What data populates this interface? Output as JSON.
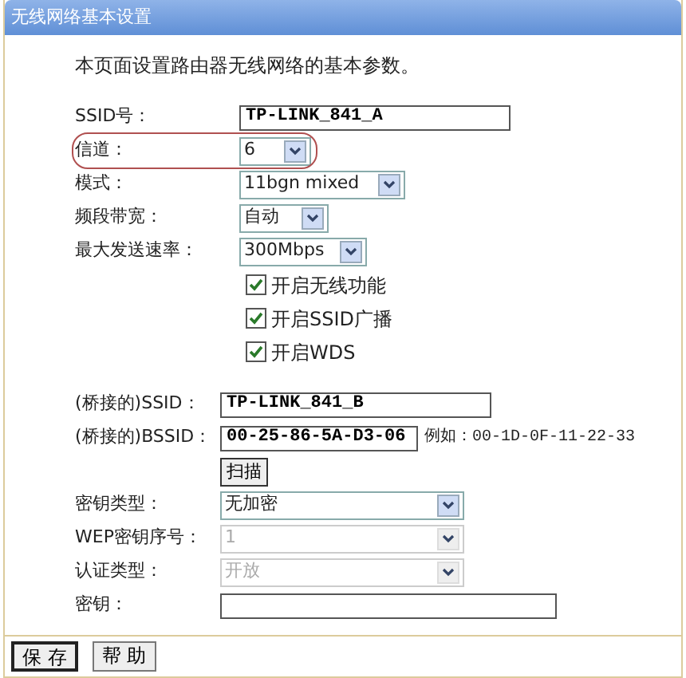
{
  "window": {
    "title": "无线网络基本设置"
  },
  "intro": "本页面设置路由器无线网络的基本参数。",
  "sections": [
    {
      "fields": [
        {
          "kind": "text",
          "label": "SSID号：",
          "value": "TP-LINK_841_A",
          "circled": false
        },
        {
          "kind": "select",
          "label": "信道：",
          "value": "6",
          "disabled": false,
          "circled": true
        },
        {
          "kind": "select",
          "label": "模式：",
          "value": "11bgn mixed",
          "disabled": false,
          "circled": false
        },
        {
          "kind": "select",
          "label": "频段带宽：",
          "value": "自动",
          "disabled": false,
          "circled": false
        },
        {
          "kind": "select",
          "label": "最大发送速率：",
          "value": "300Mbps",
          "disabled": false,
          "circled": false
        },
        {
          "kind": "checkbox",
          "text": "开启无线功能",
          "checked": true,
          "circled": false
        },
        {
          "kind": "checkbox",
          "text": "开启SSID广播",
          "checked": true,
          "circled": false
        },
        {
          "kind": "checkbox",
          "text": "开启WDS",
          "checked": true,
          "circled": false
        }
      ]
    },
    {
      "fields": [
        {
          "kind": "text",
          "label": "(桥接的)SSID：",
          "value": "TP-LINK_841_B",
          "circled": false
        },
        {
          "kind": "text",
          "label": "(桥接的)BSSID：",
          "value": "00-25-86-5A-D3-06",
          "hint": "例如：00-1D-0F-11-22-33",
          "circled": false
        },
        {
          "kind": "button",
          "text": "扫描",
          "circled": false
        },
        {
          "kind": "select",
          "label": "密钥类型：",
          "value": "无加密",
          "disabled": false,
          "circled": false
        },
        {
          "kind": "select",
          "label": "WEP密钥序号：",
          "value": "1",
          "disabled": true,
          "circled": false
        },
        {
          "kind": "select",
          "label": "认证类型：",
          "value": "开放",
          "disabled": true,
          "circled": false
        },
        {
          "kind": "text",
          "label": "密钥：",
          "circled": false
        }
      ]
    }
  ],
  "buttons": [
    {
      "label": "保 存",
      "default": true
    },
    {
      "label": "帮 助",
      "default": false
    }
  ]
}
